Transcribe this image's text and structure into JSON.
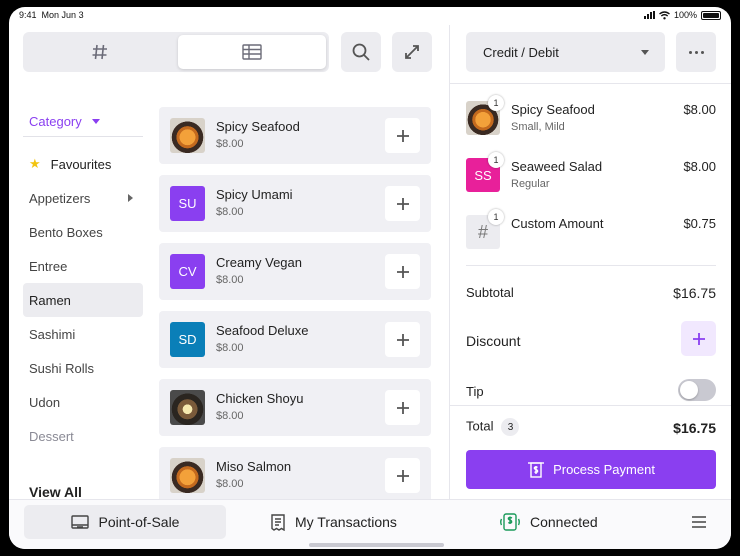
{
  "status_bar": {
    "time": "9:41",
    "date": "Mon Jun 3",
    "battery": "100%"
  },
  "toolbar": {
    "keypad_icon": "hash-icon",
    "library_icon": "table-icon",
    "search_icon": "search-icon",
    "expand_icon": "expand-icon"
  },
  "categories": {
    "header": "Category",
    "items": [
      {
        "label": "Favourites",
        "style": "fav"
      },
      {
        "label": "Appetizers",
        "style": "submenu"
      },
      {
        "label": "Bento Boxes",
        "style": ""
      },
      {
        "label": "Entree",
        "style": ""
      },
      {
        "label": "Ramen",
        "style": "active"
      },
      {
        "label": "Sashimi",
        "style": ""
      },
      {
        "label": "Sushi Rolls",
        "style": ""
      },
      {
        "label": "Udon",
        "style": ""
      },
      {
        "label": "Dessert",
        "style": "muted"
      }
    ],
    "view_all": "View All"
  },
  "products": [
    {
      "name": "Spicy Seafood",
      "price": "$8.00",
      "thumb_type": "bowl",
      "initials": "",
      "color": ""
    },
    {
      "name": "Spicy Umami",
      "price": "$8.00",
      "thumb_type": "initials",
      "initials": "SU",
      "color": "#8a3ff0"
    },
    {
      "name": "Creamy Vegan",
      "price": "$8.00",
      "thumb_type": "initials",
      "initials": "CV",
      "color": "#8a3ff0"
    },
    {
      "name": "Seafood Deluxe",
      "price": "$8.00",
      "thumb_type": "initials",
      "initials": "SD",
      "color": "#0a7fb8"
    },
    {
      "name": "Chicken Shoyu",
      "price": "$8.00",
      "thumb_type": "bowl-dark",
      "initials": "",
      "color": ""
    },
    {
      "name": "Miso Salmon",
      "price": "$8.00",
      "thumb_type": "bowl",
      "initials": "",
      "color": ""
    }
  ],
  "payment": {
    "method": "Credit / Debit"
  },
  "cart": [
    {
      "name": "Spicy Seafood",
      "modifiers": "Small, Mild",
      "price": "$8.00",
      "qty": "1",
      "thumb_type": "bowl",
      "initials": "",
      "color": ""
    },
    {
      "name": "Seaweed Salad",
      "modifiers": "Regular",
      "price": "$8.00",
      "qty": "1",
      "thumb_type": "initials",
      "initials": "SS",
      "color": "#e8209a"
    },
    {
      "name": "Custom Amount",
      "modifiers": "",
      "price": "$0.75",
      "qty": "1",
      "thumb_type": "hash",
      "initials": "#",
      "color": "#ececf0"
    }
  ],
  "summary": {
    "subtotal_label": "Subtotal",
    "subtotal": "$16.75",
    "discount_label": "Discount",
    "tip_label": "Tip",
    "tip_enabled": false,
    "total_label": "Total",
    "total_count": "3",
    "total": "$16.75"
  },
  "process_button": "Process Payment",
  "tabs": {
    "pos": "Point-of-Sale",
    "transactions": "My Transactions",
    "connected": "Connected"
  },
  "colors": {
    "accent": "#8a3ff0",
    "accent_light": "#f1e8fe",
    "star": "#f2c40f",
    "connected": "#1a9a5a"
  }
}
